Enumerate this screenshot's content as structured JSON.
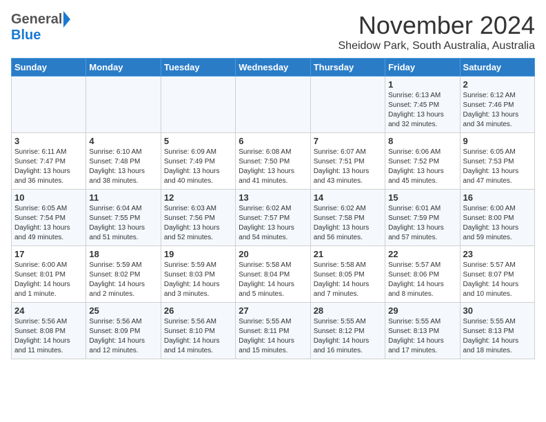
{
  "header": {
    "logo_general": "General",
    "logo_blue": "Blue",
    "month": "November 2024",
    "location": "Sheidow Park, South Australia, Australia"
  },
  "weekdays": [
    "Sunday",
    "Monday",
    "Tuesday",
    "Wednesday",
    "Thursday",
    "Friday",
    "Saturday"
  ],
  "weeks": [
    [
      {
        "day": "",
        "info": ""
      },
      {
        "day": "",
        "info": ""
      },
      {
        "day": "",
        "info": ""
      },
      {
        "day": "",
        "info": ""
      },
      {
        "day": "",
        "info": ""
      },
      {
        "day": "1",
        "info": "Sunrise: 6:13 AM\nSunset: 7:45 PM\nDaylight: 13 hours\nand 32 minutes."
      },
      {
        "day": "2",
        "info": "Sunrise: 6:12 AM\nSunset: 7:46 PM\nDaylight: 13 hours\nand 34 minutes."
      }
    ],
    [
      {
        "day": "3",
        "info": "Sunrise: 6:11 AM\nSunset: 7:47 PM\nDaylight: 13 hours\nand 36 minutes."
      },
      {
        "day": "4",
        "info": "Sunrise: 6:10 AM\nSunset: 7:48 PM\nDaylight: 13 hours\nand 38 minutes."
      },
      {
        "day": "5",
        "info": "Sunrise: 6:09 AM\nSunset: 7:49 PM\nDaylight: 13 hours\nand 40 minutes."
      },
      {
        "day": "6",
        "info": "Sunrise: 6:08 AM\nSunset: 7:50 PM\nDaylight: 13 hours\nand 41 minutes."
      },
      {
        "day": "7",
        "info": "Sunrise: 6:07 AM\nSunset: 7:51 PM\nDaylight: 13 hours\nand 43 minutes."
      },
      {
        "day": "8",
        "info": "Sunrise: 6:06 AM\nSunset: 7:52 PM\nDaylight: 13 hours\nand 45 minutes."
      },
      {
        "day": "9",
        "info": "Sunrise: 6:05 AM\nSunset: 7:53 PM\nDaylight: 13 hours\nand 47 minutes."
      }
    ],
    [
      {
        "day": "10",
        "info": "Sunrise: 6:05 AM\nSunset: 7:54 PM\nDaylight: 13 hours\nand 49 minutes."
      },
      {
        "day": "11",
        "info": "Sunrise: 6:04 AM\nSunset: 7:55 PM\nDaylight: 13 hours\nand 51 minutes."
      },
      {
        "day": "12",
        "info": "Sunrise: 6:03 AM\nSunset: 7:56 PM\nDaylight: 13 hours\nand 52 minutes."
      },
      {
        "day": "13",
        "info": "Sunrise: 6:02 AM\nSunset: 7:57 PM\nDaylight: 13 hours\nand 54 minutes."
      },
      {
        "day": "14",
        "info": "Sunrise: 6:02 AM\nSunset: 7:58 PM\nDaylight: 13 hours\nand 56 minutes."
      },
      {
        "day": "15",
        "info": "Sunrise: 6:01 AM\nSunset: 7:59 PM\nDaylight: 13 hours\nand 57 minutes."
      },
      {
        "day": "16",
        "info": "Sunrise: 6:00 AM\nSunset: 8:00 PM\nDaylight: 13 hours\nand 59 minutes."
      }
    ],
    [
      {
        "day": "17",
        "info": "Sunrise: 6:00 AM\nSunset: 8:01 PM\nDaylight: 14 hours\nand 1 minute."
      },
      {
        "day": "18",
        "info": "Sunrise: 5:59 AM\nSunset: 8:02 PM\nDaylight: 14 hours\nand 2 minutes."
      },
      {
        "day": "19",
        "info": "Sunrise: 5:59 AM\nSunset: 8:03 PM\nDaylight: 14 hours\nand 3 minutes."
      },
      {
        "day": "20",
        "info": "Sunrise: 5:58 AM\nSunset: 8:04 PM\nDaylight: 14 hours\nand 5 minutes."
      },
      {
        "day": "21",
        "info": "Sunrise: 5:58 AM\nSunset: 8:05 PM\nDaylight: 14 hours\nand 7 minutes."
      },
      {
        "day": "22",
        "info": "Sunrise: 5:57 AM\nSunset: 8:06 PM\nDaylight: 14 hours\nand 8 minutes."
      },
      {
        "day": "23",
        "info": "Sunrise: 5:57 AM\nSunset: 8:07 PM\nDaylight: 14 hours\nand 10 minutes."
      }
    ],
    [
      {
        "day": "24",
        "info": "Sunrise: 5:56 AM\nSunset: 8:08 PM\nDaylight: 14 hours\nand 11 minutes."
      },
      {
        "day": "25",
        "info": "Sunrise: 5:56 AM\nSunset: 8:09 PM\nDaylight: 14 hours\nand 12 minutes."
      },
      {
        "day": "26",
        "info": "Sunrise: 5:56 AM\nSunset: 8:10 PM\nDaylight: 14 hours\nand 14 minutes."
      },
      {
        "day": "27",
        "info": "Sunrise: 5:55 AM\nSunset: 8:11 PM\nDaylight: 14 hours\nand 15 minutes."
      },
      {
        "day": "28",
        "info": "Sunrise: 5:55 AM\nSunset: 8:12 PM\nDaylight: 14 hours\nand 16 minutes."
      },
      {
        "day": "29",
        "info": "Sunrise: 5:55 AM\nSunset: 8:13 PM\nDaylight: 14 hours\nand 17 minutes."
      },
      {
        "day": "30",
        "info": "Sunrise: 5:55 AM\nSunset: 8:13 PM\nDaylight: 14 hours\nand 18 minutes."
      }
    ]
  ]
}
